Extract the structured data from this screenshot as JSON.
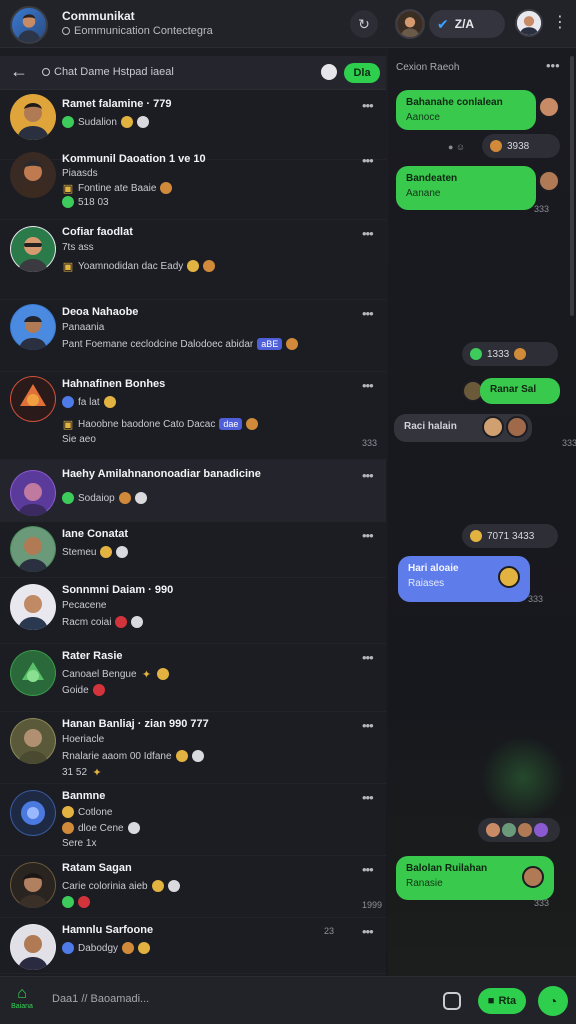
{
  "header": {
    "title": "Communikat",
    "subtitle": "Eommunication Contectegra",
    "pill_label": "Z/A"
  },
  "left_header": {
    "breadcrumb": "Chat Dame   Hstpad iaeal",
    "online_label": "Dla"
  },
  "chats": [
    {
      "name": "Ramet falamine  ·  779",
      "line1": "Sudalion",
      "line2": "",
      "time": "",
      "color": "#e0a53a"
    },
    {
      "name": "Kommunil Daoation   1 ve   10",
      "line1": "Piaasds",
      "line2": "Fontine ate  Baaie",
      "line3": "518  03",
      "time": "",
      "color": "#c86a3a"
    },
    {
      "name": "Cofiar faodlat",
      "line1": "7ts ass",
      "line2": "Yoamnodidan  dac  Eady",
      "line3": "",
      "time": "",
      "color": "#3aa06a"
    },
    {
      "name": "Deoa Nahaobe",
      "line1": "Panaania",
      "line2": "Pant  Foemane ceclodcine Dalodoec abidar",
      "line3": "",
      "time": "",
      "color": "#3a7ad0",
      "tag": "aBE"
    },
    {
      "name": "Hahnafinen Bonhes",
      "line1": "fa lat",
      "line2": "Haoobne baodone  Cato  Dacac",
      "line3": "Sie aeo",
      "time": "333",
      "color": "#d0503a",
      "tag": "dae"
    },
    {
      "name": "Haehy Amilahnanonoadiar banadicine",
      "line1": "Sodaiop",
      "line2": "",
      "line3": "",
      "time": "",
      "color": "#8a5ad0"
    },
    {
      "name": "Iane Conatat",
      "line1": "Stemeu",
      "line2": "",
      "line3": "",
      "time": "",
      "color": "#4a8a5a"
    },
    {
      "name": "Sonnmni Daiam  ·  990",
      "line1": "Pecacene",
      "line2": "Racm coiai",
      "line3": "",
      "time": "",
      "color": "#5a6a8a"
    },
    {
      "name": "Rater Rasie",
      "line1": "Canoael Bengue",
      "line2": "Goide",
      "line3": "",
      "time": "",
      "color": "#3a9a4a"
    },
    {
      "name": "Hanan Banliaj  ·  zian   990   777",
      "line1": "Hoeriacle",
      "line2": "Rnalarie aaom   00   Idfane",
      "line3": "31 52",
      "time": "",
      "color": "#8a8a5a"
    },
    {
      "name": "Banmne",
      "line1": "Cotlone",
      "line2": "dloe  Cene",
      "line3": "Sere 1x",
      "time": "",
      "color": "#3a5aa0"
    },
    {
      "name": "Ratam Sagan",
      "line1": "Carie colorinia  aieb",
      "line2": "",
      "line3": "",
      "time": "1999",
      "color": "#6a5a3a"
    },
    {
      "name": "Hamnlu Sarfoone",
      "line1": "Dabodgy",
      "line2": "",
      "line3": "",
      "time": "",
      "color": "#5a4a8a",
      "meta": "23"
    }
  ],
  "right": {
    "title": "Cexion Raeoh",
    "messages": [
      {
        "t1": "Bahanahe conlalean",
        "t2": "Aanoce",
        "ts": ""
      },
      {
        "react": "3938",
        "ts": ""
      },
      {
        "t1": "Bandeaten",
        "t2": "Aanane",
        "ts": "333"
      },
      {
        "react": "1333",
        "ts": ""
      },
      {
        "react": "Ranar Sal",
        "ts": ""
      },
      {
        "t1": "Raci halain",
        "t2": "",
        "ts": "333"
      },
      {
        "react": "7071  3433",
        "ts": ""
      },
      {
        "t1": "Hari aloaie",
        "t2": "Raiases",
        "ts": "333"
      },
      {
        "t1": "Balolan Ruilahan",
        "t2": "Ranasie",
        "ts": "333"
      }
    ]
  },
  "bottom": {
    "home_label": "Baiana",
    "compose_placeholder": "Daa1 // Baoamadi...",
    "send_label": "Rta"
  }
}
